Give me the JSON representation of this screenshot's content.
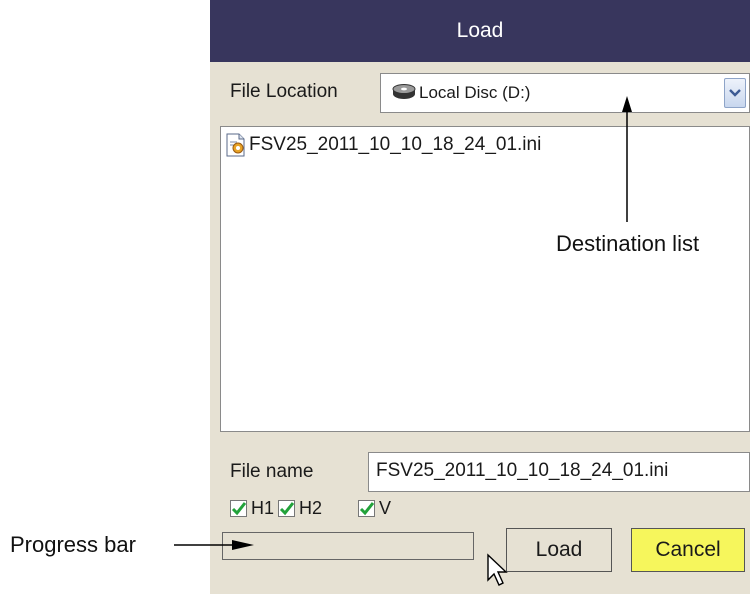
{
  "dialog": {
    "title": "Load",
    "file_location_label": "File Location",
    "file_location_value": "Local Disc (D:)",
    "files": [
      "FSV25_2011_10_10_18_24_01.ini"
    ],
    "file_name_label": "File name",
    "file_name_value": "FSV25_2011_10_10_18_24_01.ini",
    "checkboxes": [
      {
        "label": "H1",
        "checked": true
      },
      {
        "label": "H2",
        "checked": true
      },
      {
        "label": "V",
        "checked": true
      }
    ],
    "progress": 0,
    "buttons": {
      "load": "Load",
      "cancel": "Cancel"
    }
  },
  "annotations": {
    "destination_list": "Destination list",
    "progress_bar": "Progress bar"
  },
  "colors": {
    "title_bar": "#38365d",
    "dialog_bg": "#e6e1d3",
    "cancel_button": "#f6f65c",
    "checkmark": "#22a23a"
  },
  "icons": [
    "disk-icon",
    "ini-file-icon",
    "chevron-down-icon",
    "checkmark-icon",
    "mouse-cursor-icon"
  ]
}
